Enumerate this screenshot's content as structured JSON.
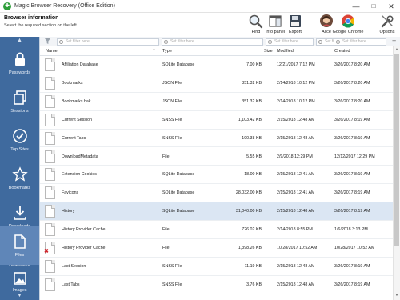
{
  "window": {
    "title": "Magic Browser Recovery (Office Edition)",
    "minimize": "—",
    "maximize": "□",
    "close": "✕"
  },
  "header": {
    "title": "Browser information",
    "subtitle": "Select the required section on the left"
  },
  "toolbar": [
    {
      "name": "find",
      "label": "Find",
      "icon": "magnifier-icon"
    },
    {
      "name": "info-panel",
      "label": "Info panel",
      "icon": "info-panel-icon"
    },
    {
      "name": "export",
      "label": "Export",
      "icon": "floppy-disk-icon"
    },
    {
      "name": "alice",
      "label": "Alice",
      "icon": "user-avatar-icon"
    },
    {
      "name": "google-chrome",
      "label": "Google Chrome",
      "icon": "chrome-icon"
    },
    {
      "name": "options",
      "label": "Options",
      "icon": "wrench-icon"
    }
  ],
  "sidebar": {
    "items": [
      {
        "label": "Passwords",
        "icon": "lock-icon"
      },
      {
        "label": "Sessions",
        "icon": "sessions-icon"
      },
      {
        "label": "Top Sites",
        "icon": "checkmark-icon"
      },
      {
        "label": "Bookmarks",
        "icon": "star-icon"
      },
      {
        "label": "Downloads",
        "icon": "download-icon"
      },
      {
        "label": "Addresses",
        "icon": "home-icon"
      },
      {
        "label": "Files",
        "icon": "files-icon",
        "active": true
      },
      {
        "label": "Images",
        "icon": "image-icon"
      }
    ],
    "accent": "#3f6a9e",
    "active_color": "#5f86b8"
  },
  "filters": {
    "placeholder": "Set filter here..."
  },
  "columns": [
    "Name",
    "Type",
    "Size",
    "Modified",
    "Created"
  ],
  "rows": [
    {
      "name": "Affiliation Database",
      "type": "SQLite Database",
      "size": "7.00 KB",
      "modified": "12/21/2017 7:12 PM",
      "created": "3/26/2017 8:20 AM"
    },
    {
      "name": "Bookmarks",
      "type": "JSON File",
      "size": "351.32 KB",
      "modified": "2/14/2018 10:12 PM",
      "created": "3/26/2017 8:20 AM"
    },
    {
      "name": "Bookmarks.bak",
      "type": "JSON File",
      "size": "351.32 KB",
      "modified": "2/14/2018 10:12 PM",
      "created": "3/26/2017 8:20 AM"
    },
    {
      "name": "Current Session",
      "type": "SNSS File",
      "size": "1,103.42 KB",
      "modified": "2/15/2018 12:48 AM",
      "created": "3/26/2017 8:19 AM"
    },
    {
      "name": "Current Tabs",
      "type": "SNSS File",
      "size": "190.38 KB",
      "modified": "2/15/2018 12:48 AM",
      "created": "3/26/2017 8:19 AM"
    },
    {
      "name": "DownloadMetadata",
      "type": "File",
      "size": "5.55 KB",
      "modified": "2/9/2018 12:29 PM",
      "created": "12/12/2017 12:29 PM"
    },
    {
      "name": "Extension Cookies",
      "type": "SQLite Database",
      "size": "18.00 KB",
      "modified": "2/15/2018 12:41 AM",
      "created": "3/26/2017 8:19 AM"
    },
    {
      "name": "Favicons",
      "type": "SQLite Database",
      "size": "28,032.00 KB",
      "modified": "2/15/2018 12:41 AM",
      "created": "3/26/2017 8:19 AM"
    },
    {
      "name": "History",
      "type": "SQLite Database",
      "size": "31,040.00 KB",
      "modified": "2/15/2018 12:48 AM",
      "created": "3/26/2017 8:19 AM",
      "selected": true
    },
    {
      "name": "History Provider Cache",
      "type": "File",
      "size": "726.02 KB",
      "modified": "2/14/2018 8:55 PM",
      "created": "1/6/2018 3:13 PM"
    },
    {
      "name": "History Provider Cache",
      "type": "File",
      "size": "1,398.26 KB",
      "modified": "10/28/2017 10:52 AM",
      "created": "10/28/2017 10:52 AM",
      "deleted": true
    },
    {
      "name": "Last Session",
      "type": "SNSS File",
      "size": "11.19 KB",
      "modified": "2/15/2018 12:48 AM",
      "created": "3/26/2017 8:19 AM"
    },
    {
      "name": "Last Tabs",
      "type": "SNSS File",
      "size": "3.76 KB",
      "modified": "2/15/2018 12:48 AM",
      "created": "3/26/2017 8:19 AM"
    }
  ]
}
